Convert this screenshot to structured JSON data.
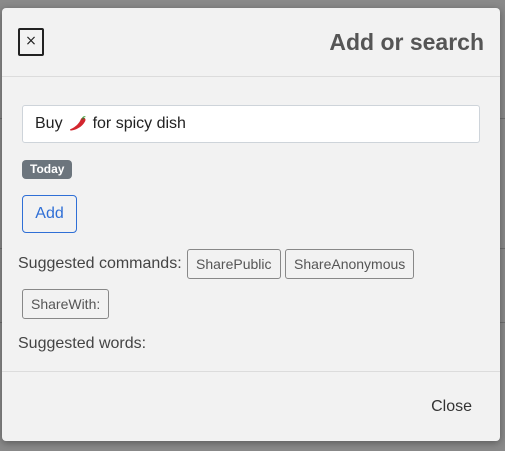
{
  "modal": {
    "title": "Add or search",
    "close_icon_glyph": "×",
    "input_value_before": "Buy",
    "input_emoji": "chili-pepper-emoji",
    "input_value_after": "for spicy dish",
    "date_badge": "Today",
    "add_label": "Add",
    "suggested_commands_label": "Suggested commands:",
    "commands": [
      "SharePublic",
      "ShareAnonymous",
      "ShareWith:"
    ],
    "suggested_words_label": "Suggested words:",
    "close_label": "Close"
  },
  "colors": {
    "badge": "#6c757d",
    "primary": "#2f6fd6",
    "modal_bg": "#f2f2f2"
  }
}
